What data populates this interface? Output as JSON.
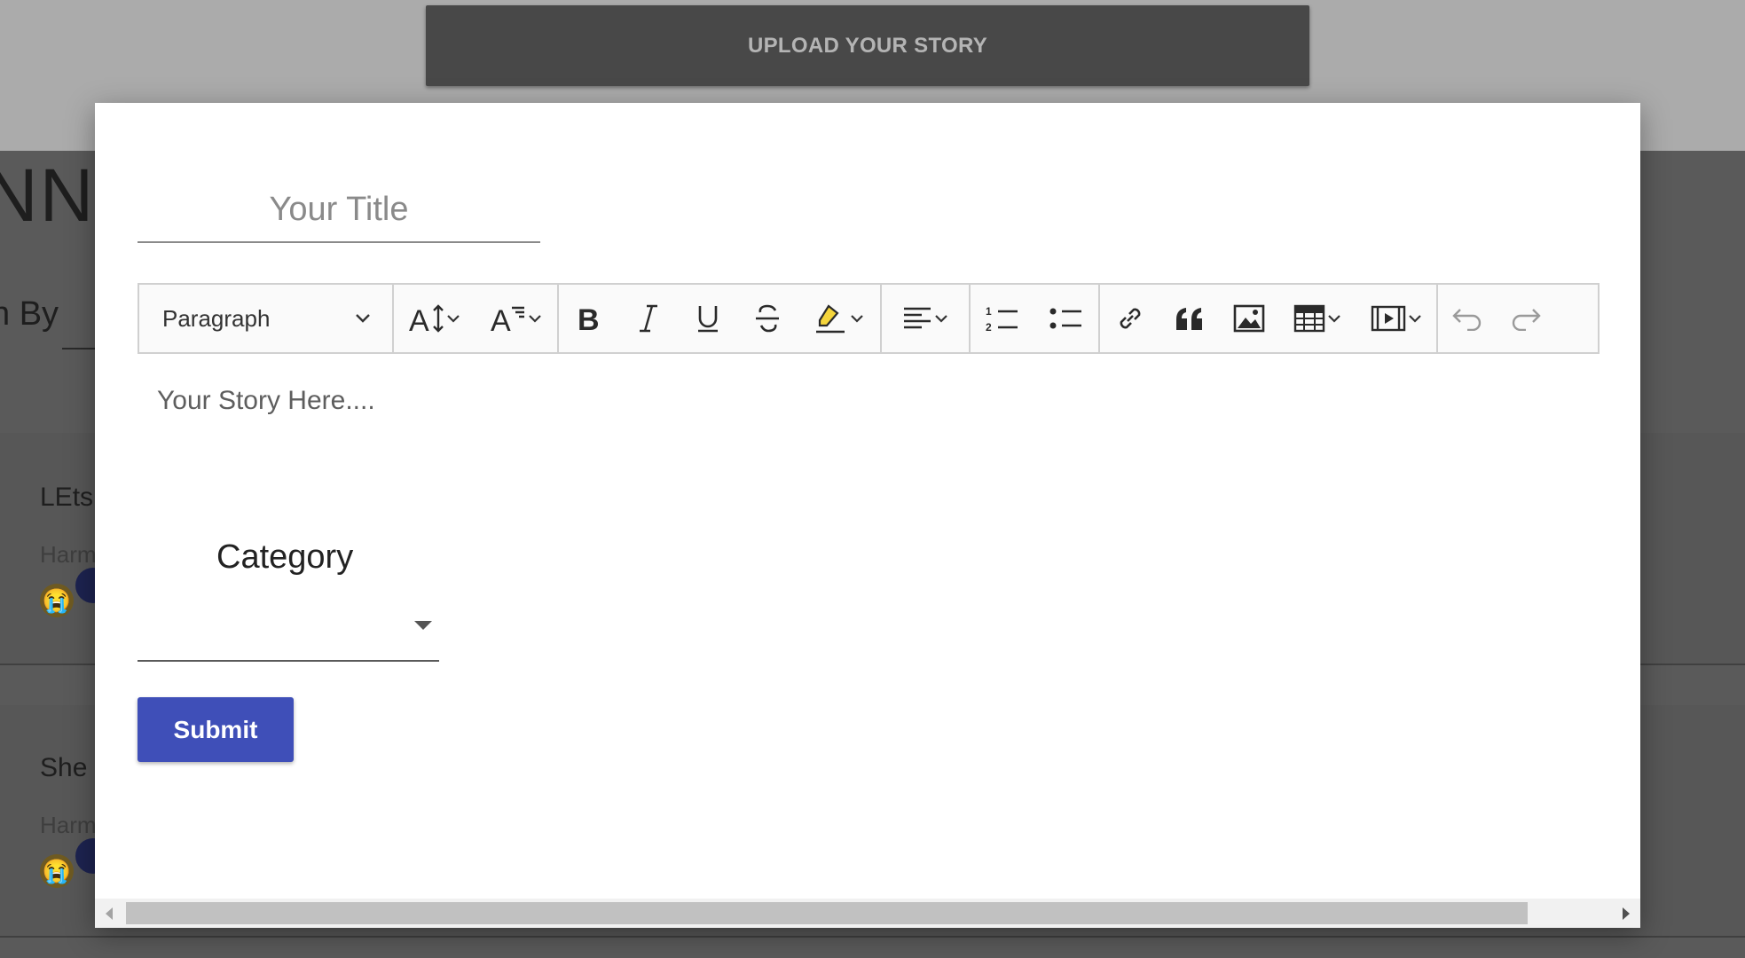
{
  "header": {
    "upload_button_label": "UPLOAD YOUR STORY"
  },
  "background": {
    "heading_fragment": "NNY",
    "sort_label_fragment": "n By",
    "cards": [
      {
        "title_fragment": "LEts",
        "author_fragment": "Harm"
      },
      {
        "title_fragment": "She",
        "author_fragment": "Harm"
      }
    ]
  },
  "modal": {
    "title_placeholder": "Your Title",
    "editor": {
      "heading_select": "Paragraph",
      "placeholder": "Your Story Here....",
      "toolbar_icons": [
        "font-size-icon",
        "font-family-icon",
        "bold-icon",
        "italic-icon",
        "underline-icon",
        "strikethrough-icon",
        "highlight-icon",
        "align-icon",
        "numbered-list-icon",
        "bulleted-list-icon",
        "link-icon",
        "blockquote-icon",
        "image-icon",
        "table-icon",
        "media-icon",
        "undo-icon",
        "redo-icon"
      ]
    },
    "category_label": "Category",
    "category_value": "",
    "submit_label": "Submit"
  },
  "colors": {
    "submit_button": "#3f4fb8",
    "overlay_top": "#ababab",
    "upload_bar": "#484848",
    "modal_background": "#ffffff"
  }
}
